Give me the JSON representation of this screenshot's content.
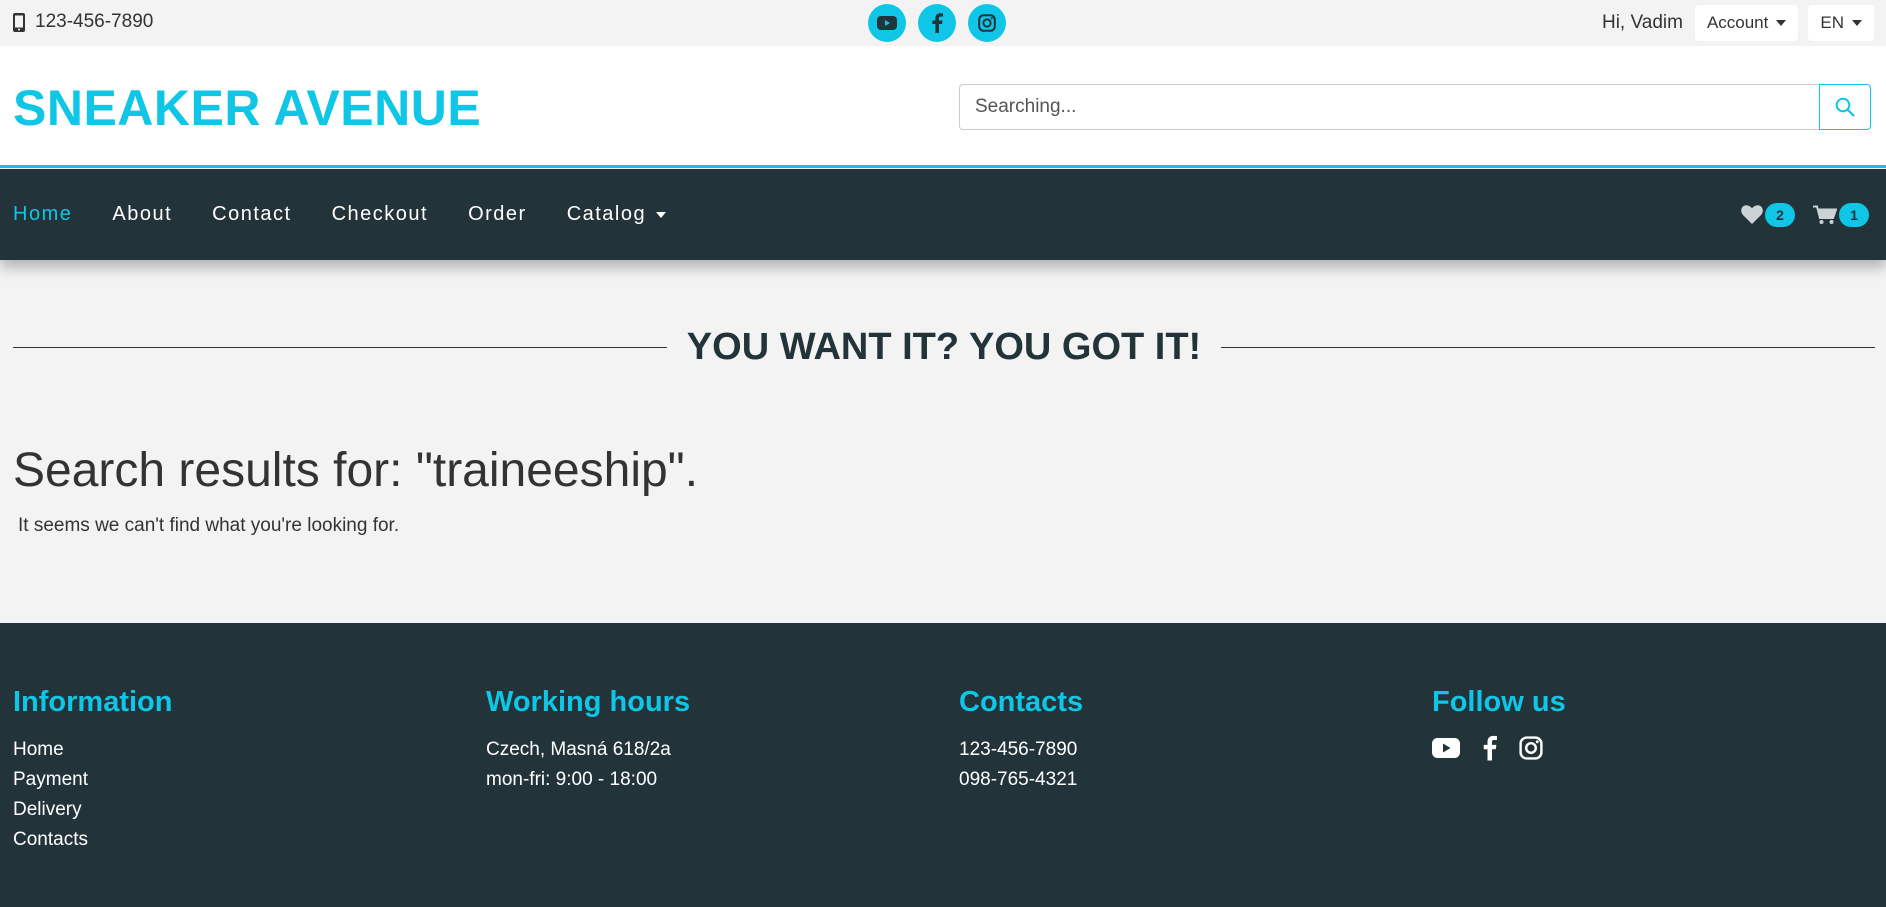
{
  "topbar": {
    "phone": "123-456-7890",
    "greeting": "Hi, Vadim",
    "account_label": "Account",
    "language_label": "EN"
  },
  "header": {
    "logo": "SNEAKER AVENUE",
    "search_placeholder": "Searching..."
  },
  "nav": {
    "items": [
      {
        "label": "Home"
      },
      {
        "label": "About"
      },
      {
        "label": "Contact"
      },
      {
        "label": "Checkout"
      },
      {
        "label": "Order"
      },
      {
        "label": "Catalog"
      }
    ],
    "wishlist_count": "2",
    "cart_count": "1"
  },
  "main": {
    "slogan": "YOU WANT IT? YOU GOT IT!",
    "results_title": "Search results for: \"traineeship\".",
    "results_message": "It seems we can't find what you're looking for."
  },
  "footer": {
    "information": {
      "title": "Information",
      "links": [
        "Home",
        "Payment",
        "Delivery",
        "Contacts"
      ]
    },
    "working_hours": {
      "title": "Working hours",
      "lines": [
        "Czech, Masná 618/2a",
        "mon-fri: 9:00 - 18:00"
      ]
    },
    "contacts": {
      "title": "Contacts",
      "lines": [
        "123-456-7890",
        "098-765-4321"
      ]
    },
    "follow": {
      "title": "Follow us"
    }
  },
  "colors": {
    "accent": "#0fc6e6",
    "dark": "#22343a",
    "background": "#f3f3f3"
  },
  "icons": [
    "phone-icon",
    "youtube-icon",
    "facebook-icon",
    "instagram-icon",
    "search-icon",
    "heart-icon",
    "cart-icon"
  ]
}
